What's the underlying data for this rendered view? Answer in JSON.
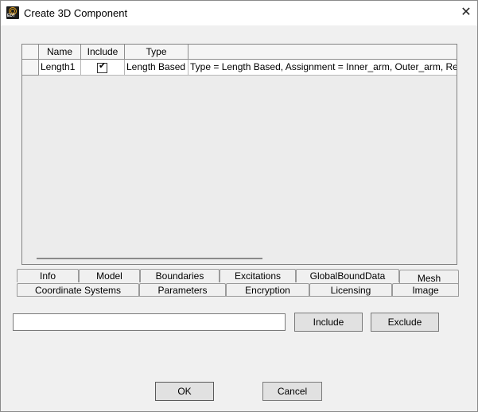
{
  "window": {
    "title": "Create 3D Component",
    "app_icon_text": "EDT"
  },
  "grid": {
    "columns": [
      "Name",
      "Include",
      "Type",
      ""
    ],
    "rows": [
      {
        "name": "Length1",
        "include": true,
        "type": "Length Based",
        "details": "Type = Length Based, Assignment = Inner_arm, Outer_arm, Region = In"
      }
    ]
  },
  "tabs_row1": [
    "Info",
    "Model",
    "Boundaries",
    "Excitations",
    "GlobalBoundData",
    "Mesh"
  ],
  "tabs_row2": [
    "Coordinate Systems",
    "Parameters",
    "Encryption",
    "Licensing",
    "Image"
  ],
  "active_tab": "Mesh",
  "filter": {
    "value": ""
  },
  "buttons": {
    "include": "Include",
    "exclude": "Exclude",
    "ok": "OK",
    "cancel": "Cancel"
  },
  "icons": {
    "close": "close-icon",
    "check": "check-icon"
  }
}
